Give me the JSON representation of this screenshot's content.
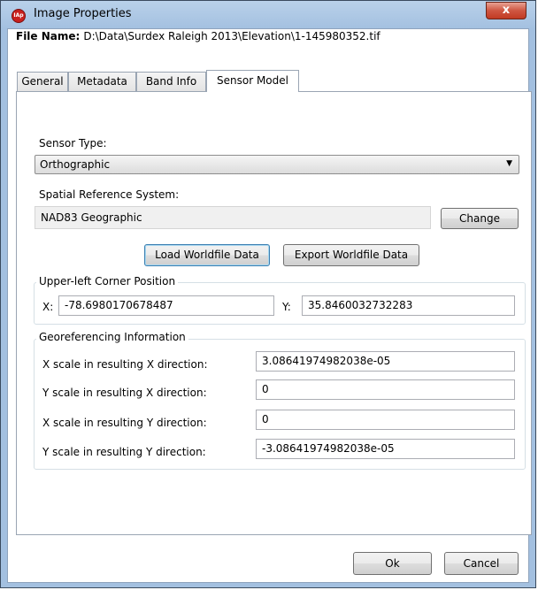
{
  "window": {
    "title": "Image Properties",
    "app_icon_text": "IAp",
    "close_glyph": "x"
  },
  "file": {
    "label": "File Name:",
    "value": "D:\\Data\\Surdex Raleigh 2013\\Elevation\\1-145980352.tif"
  },
  "tabs": [
    {
      "label": "General"
    },
    {
      "label": "Metadata"
    },
    {
      "label": "Band Info"
    },
    {
      "label": "Sensor Model",
      "active": true
    }
  ],
  "sensor": {
    "type_label": "Sensor Type:",
    "type_value": "Orthographic"
  },
  "srs": {
    "label": "Spatial Reference System:",
    "value": "NAD83 Geographic",
    "change_label": "Change"
  },
  "worldfile": {
    "load_label": "Load Worldfile Data",
    "export_label": "Export Worldfile Data"
  },
  "corner": {
    "title": "Upper-left Corner Position",
    "x_label": "X:",
    "x_value": "-78.6980170678487",
    "y_label": "Y:",
    "y_value": "35.8460032732283"
  },
  "georef": {
    "title": "Georeferencing Information",
    "rows": [
      {
        "label": "X scale in resulting X direction:",
        "value": "3.08641974982038e-05"
      },
      {
        "label": "Y scale in resulting X direction:",
        "value": "0"
      },
      {
        "label": "X scale in resulting Y direction:",
        "value": "0"
      },
      {
        "label": "Y scale in resulting Y direction:",
        "value": "-3.08641974982038e-05"
      }
    ]
  },
  "footer": {
    "ok_label": "Ok",
    "cancel_label": "Cancel"
  }
}
